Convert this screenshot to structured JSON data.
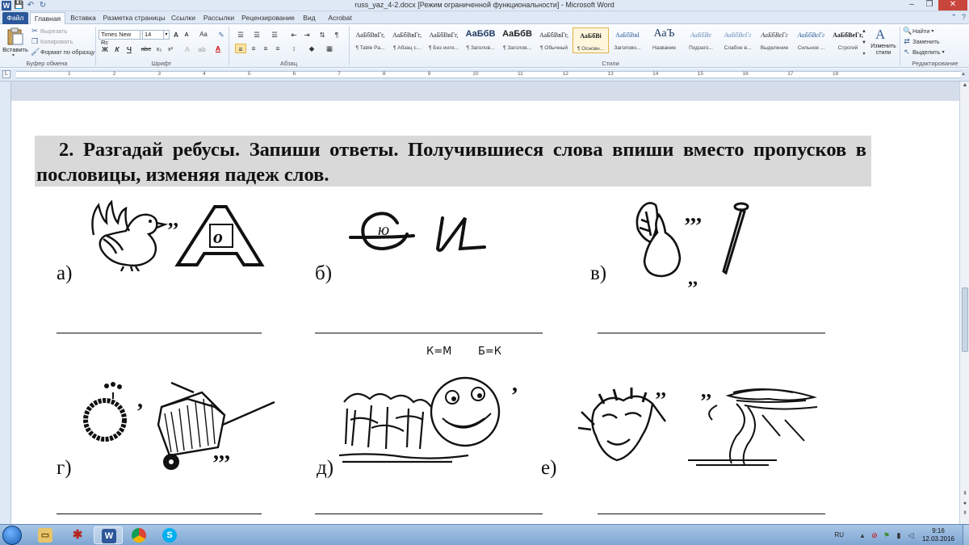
{
  "window": {
    "title": "russ_yaz_4-2.docx [Режим ограниченной функциональности] - Microsoft Word",
    "app_letter": "W",
    "minimize": "–",
    "maximize": "❐",
    "close": "✕"
  },
  "quick_access": {
    "save": "💾",
    "undo": "↶",
    "redo": "↻"
  },
  "tabs": [
    "Файл",
    "Главная",
    "Вставка",
    "Разметка страницы",
    "Ссылки",
    "Рассылки",
    "Рецензирование",
    "Вид",
    "Acrobat"
  ],
  "active_tab": "Главная",
  "ribbon": {
    "clipboard": {
      "paste": "Вставить",
      "cut": "Вырезать",
      "copy": "Копировать",
      "format_painter": "Формат по образцу",
      "group": "Буфер обмена"
    },
    "font": {
      "name": "Times New Rc",
      "size": "14",
      "bold": "Ж",
      "italic": "К",
      "underline": "Ч",
      "strike": "abe",
      "subscript": "x₂",
      "superscript": "x²",
      "grow": "A",
      "shrink": "A",
      "case": "Aa",
      "group": "Шрифт"
    },
    "paragraph": {
      "group": "Абзац",
      "pilcrow": "¶"
    },
    "styles": {
      "group": "Стили",
      "items": [
        {
          "preview": "АаБбВвГг,",
          "name": "¶ Table Pa..."
        },
        {
          "preview": "АаБбВвГг,",
          "name": "¶ Абзац с..."
        },
        {
          "preview": "АаБбВвГг,",
          "name": "¶ Без инте..."
        },
        {
          "preview": "АаБбВ",
          "name": "¶ Заголов..."
        },
        {
          "preview": "АаБбВ",
          "name": "¶ Заголов..."
        },
        {
          "preview": "АаБбВвГг,",
          "name": "¶ Обычный"
        },
        {
          "preview": "АаБбВі",
          "name": "¶ Основн..."
        },
        {
          "preview": "АаБбВвІ",
          "name": "Заголово..."
        },
        {
          "preview": "АаЪ",
          "name": "Название"
        },
        {
          "preview": "АаБбВе",
          "name": "Подзаго..."
        },
        {
          "preview": "АаБбВеГг",
          "name": "Слабое в..."
        },
        {
          "preview": "АаБбВеГг",
          "name": "Выделение"
        },
        {
          "preview": "АаБбВеГг",
          "name": "Сильное ..."
        },
        {
          "preview": "АаБбВеГг,",
          "name": "Строгий"
        }
      ],
      "change_styles": "Изменить стили"
    },
    "editing": {
      "find": "Найти",
      "replace": "Заменить",
      "select": "Выделить",
      "group": "Редактирование"
    }
  },
  "ruler": {
    "numbers": [
      "1",
      "2",
      "3",
      "4",
      "5",
      "6",
      "7",
      "8",
      "9",
      "10",
      "11",
      "12",
      "13",
      "14",
      "15",
      "16",
      "17",
      "18"
    ]
  },
  "document": {
    "task_number": "2.",
    "task_text": "Разгадай ребусы. Запиши ответы. Получившиеся слова впиши вместо пропусков в пословицы, изменяя падеж слов.",
    "labels": [
      "а)",
      "б)",
      "в)",
      "г)",
      "д)",
      "е)"
    ],
    "rebus_b_text": "ю",
    "rebus_d_hints": [
      "К=М",
      "Б=К"
    ]
  },
  "taskbar": {
    "lang": "RU",
    "time": "9:16",
    "date": "12.03.2016",
    "word_letter": "W",
    "skype_letter": "S"
  }
}
